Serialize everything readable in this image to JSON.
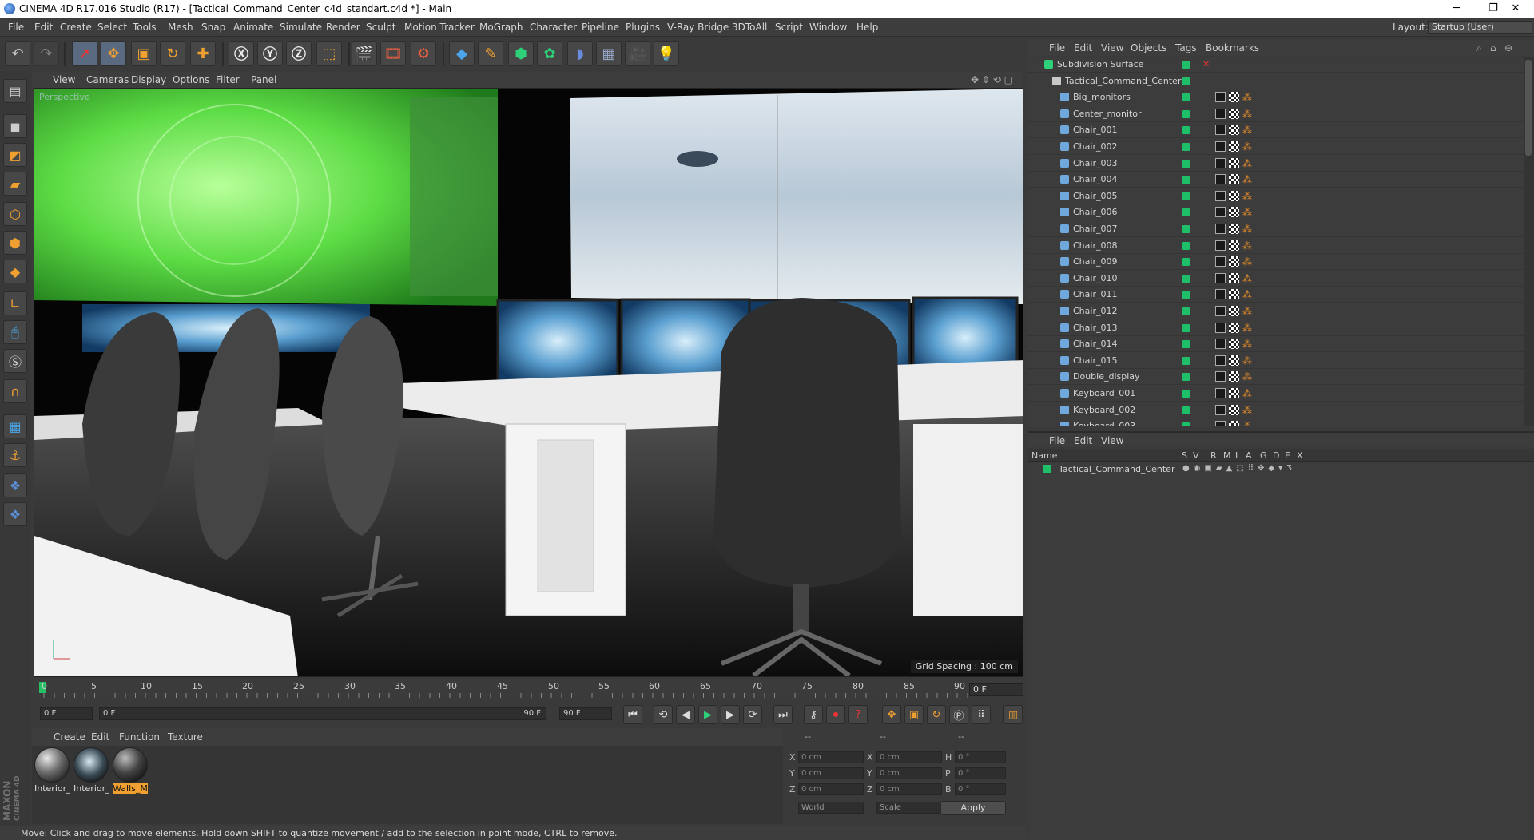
{
  "window": {
    "title": "CINEMA 4D R17.016 Studio (R17) - [Tactical_Command_Center_c4d_standart.c4d *] - Main",
    "controls": [
      "─",
      "❐",
      "✕"
    ]
  },
  "menubar": {
    "items": [
      "File",
      "Edit",
      "Create",
      "Select",
      "Tools",
      "Mesh",
      "Snap",
      "Animate",
      "Simulate",
      "Render",
      "Sculpt",
      "Motion Tracker",
      "MoGraph",
      "Character",
      "Pipeline",
      "Plugins",
      "V-Ray Bridge",
      "3DToAll",
      "Script",
      "Window",
      "Help"
    ],
    "layout_label": "Layout:",
    "layout_value": "Startup (User)"
  },
  "viewport": {
    "menu": [
      "View",
      "Cameras",
      "Display",
      "Options",
      "Filter",
      "Panel"
    ],
    "camera_label": "Perspective",
    "grid_spacing": "Grid Spacing : 100 cm"
  },
  "timeline": {
    "ticks": [
      "0",
      "5",
      "10",
      "15",
      "20",
      "25",
      "30",
      "35",
      "40",
      "45",
      "50",
      "55",
      "60",
      "65",
      "70",
      "75",
      "80",
      "85",
      "90"
    ],
    "current_frame": "0 F"
  },
  "transport": {
    "start_field": "0 F",
    "range_start": "0 F",
    "range_end": "90 F",
    "end_field": "90 F"
  },
  "material_manager": {
    "menu": [
      "Create",
      "Edit",
      "Function",
      "Texture"
    ],
    "materials": [
      {
        "label": "Interior_",
        "selected": false
      },
      {
        "label": "Interior_",
        "selected": false
      },
      {
        "label": "Walls_M",
        "selected": true
      }
    ],
    "brand_line1": "MAXON",
    "brand_line2": "CINEMA 4D"
  },
  "coordinates": {
    "col_headers": [
      "--",
      "--",
      "--"
    ],
    "rows": [
      {
        "axis": "X",
        "pos": "0 cm",
        "axis2": "X",
        "size": "0 cm",
        "rot_axis": "H",
        "rot": "0 °"
      },
      {
        "axis": "Y",
        "pos": "0 cm",
        "axis2": "Y",
        "size": "0 cm",
        "rot_axis": "P",
        "rot": "0 °"
      },
      {
        "axis": "Z",
        "pos": "0 cm",
        "axis2": "Z",
        "size": "0 cm",
        "rot_axis": "B",
        "rot": "0 °"
      }
    ],
    "coord_mode": "World",
    "size_mode": "Scale",
    "apply_label": "Apply"
  },
  "status": "Move: Click and drag to move elements. Hold down SHIFT to quantize movement / add to the selection in point mode, CTRL to remove.",
  "object_manager": {
    "menu": [
      "File",
      "Edit",
      "View",
      "Objects",
      "Tags",
      "Bookmarks"
    ],
    "rows": [
      {
        "name": "Subdivision Surface",
        "level": 0,
        "kind": "subdiv"
      },
      {
        "name": "Tactical_Command_Center",
        "level": 1,
        "kind": "null"
      },
      {
        "name": "Big_monitors",
        "level": 2,
        "kind": "mesh"
      },
      {
        "name": "Center_monitor",
        "level": 2,
        "kind": "mesh"
      },
      {
        "name": "Chair_001",
        "level": 2,
        "kind": "mesh"
      },
      {
        "name": "Chair_002",
        "level": 2,
        "kind": "mesh"
      },
      {
        "name": "Chair_003",
        "level": 2,
        "kind": "mesh"
      },
      {
        "name": "Chair_004",
        "level": 2,
        "kind": "mesh"
      },
      {
        "name": "Chair_005",
        "level": 2,
        "kind": "mesh"
      },
      {
        "name": "Chair_006",
        "level": 2,
        "kind": "mesh"
      },
      {
        "name": "Chair_007",
        "level": 2,
        "kind": "mesh"
      },
      {
        "name": "Chair_008",
        "level": 2,
        "kind": "mesh"
      },
      {
        "name": "Chair_009",
        "level": 2,
        "kind": "mesh"
      },
      {
        "name": "Chair_010",
        "level": 2,
        "kind": "mesh"
      },
      {
        "name": "Chair_011",
        "level": 2,
        "kind": "mesh"
      },
      {
        "name": "Chair_012",
        "level": 2,
        "kind": "mesh"
      },
      {
        "name": "Chair_013",
        "level": 2,
        "kind": "mesh"
      },
      {
        "name": "Chair_014",
        "level": 2,
        "kind": "mesh"
      },
      {
        "name": "Chair_015",
        "level": 2,
        "kind": "mesh"
      },
      {
        "name": "Double_display",
        "level": 2,
        "kind": "mesh"
      },
      {
        "name": "Keyboard_001",
        "level": 2,
        "kind": "mesh"
      },
      {
        "name": "Keyboard_002",
        "level": 2,
        "kind": "mesh"
      },
      {
        "name": "Keyboard_003",
        "level": 2,
        "kind": "mesh"
      }
    ]
  },
  "layer_manager": {
    "menu": [
      "File",
      "Edit",
      "View"
    ],
    "columns": [
      "Name",
      "S",
      "V",
      "R",
      "M",
      "L",
      "A",
      "G",
      "D",
      "E",
      "X"
    ],
    "layers": [
      "Tactical_Command_Center"
    ]
  },
  "colors": {
    "accent_green": "#1fbf6a",
    "selection_orange": "#f0a030"
  }
}
